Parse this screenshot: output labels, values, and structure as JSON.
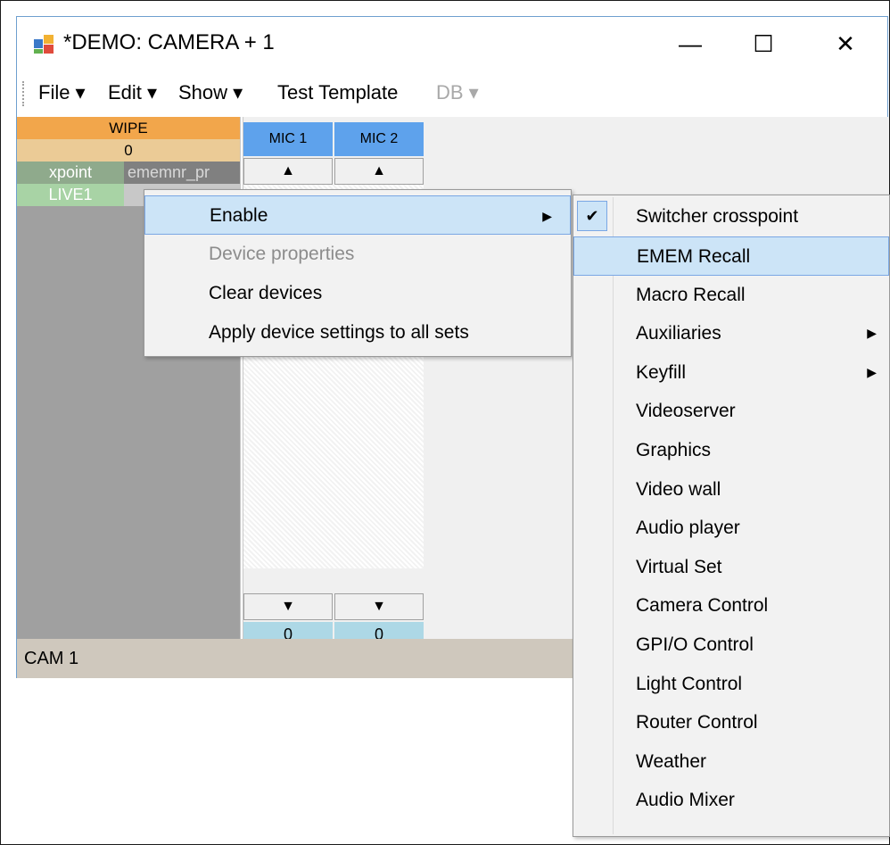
{
  "window": {
    "title": "*DEMO: CAMERA + 1",
    "controls": {
      "minimize": "—",
      "maximize": "☐",
      "close": "✕"
    }
  },
  "menubar": {
    "items": [
      {
        "label": "File ▾"
      },
      {
        "label": "Edit ▾"
      },
      {
        "label": "Show ▾"
      },
      {
        "label": "Test Template"
      },
      {
        "label": "DB ▾",
        "disabled": true
      }
    ]
  },
  "left_panel": {
    "header": "WIPE",
    "value": "0",
    "row1": {
      "col1": "xpoint",
      "col2": "ememnr_pr"
    },
    "row2": {
      "col1": "LIVE1",
      "col2": ""
    }
  },
  "channels": [
    {
      "name": "MIC 1",
      "up": "▲",
      "down": "▼",
      "value": "0"
    },
    {
      "name": "MIC 2",
      "up": "▲",
      "down": "▼",
      "value": "0"
    }
  ],
  "status_bar": {
    "text": "CAM 1"
  },
  "context_menu": {
    "items": [
      {
        "label": "Enable",
        "highlighted": true,
        "submenu_arrow": "▶"
      },
      {
        "label": "Device properties",
        "disabled": true
      },
      {
        "label": "Clear devices"
      },
      {
        "label": "Apply device settings to all sets"
      }
    ]
  },
  "submenu": {
    "check_mark": "✔",
    "items": [
      {
        "label": "Switcher crosspoint",
        "checked": true
      },
      {
        "label": "EMEM Recall",
        "highlighted": true
      },
      {
        "label": "Macro Recall"
      },
      {
        "label": "Auxiliaries",
        "arrow": "▶"
      },
      {
        "label": "Keyfill",
        "arrow": "▶"
      },
      {
        "label": "Videoserver"
      },
      {
        "label": "Graphics"
      },
      {
        "label": "Video wall"
      },
      {
        "label": "Audio player"
      },
      {
        "label": "Virtual Set"
      },
      {
        "label": "Camera Control"
      },
      {
        "label": "GPI/O Control"
      },
      {
        "label": "Light Control"
      },
      {
        "label": "Router Control"
      },
      {
        "label": "Weather"
      },
      {
        "label": "Audio Mixer"
      }
    ]
  },
  "colors": {
    "wipe_header": "#f2a64b",
    "mic_header": "#5ea2ec",
    "highlight": "#cce4f7",
    "status_bar": "#cfc8bd"
  }
}
